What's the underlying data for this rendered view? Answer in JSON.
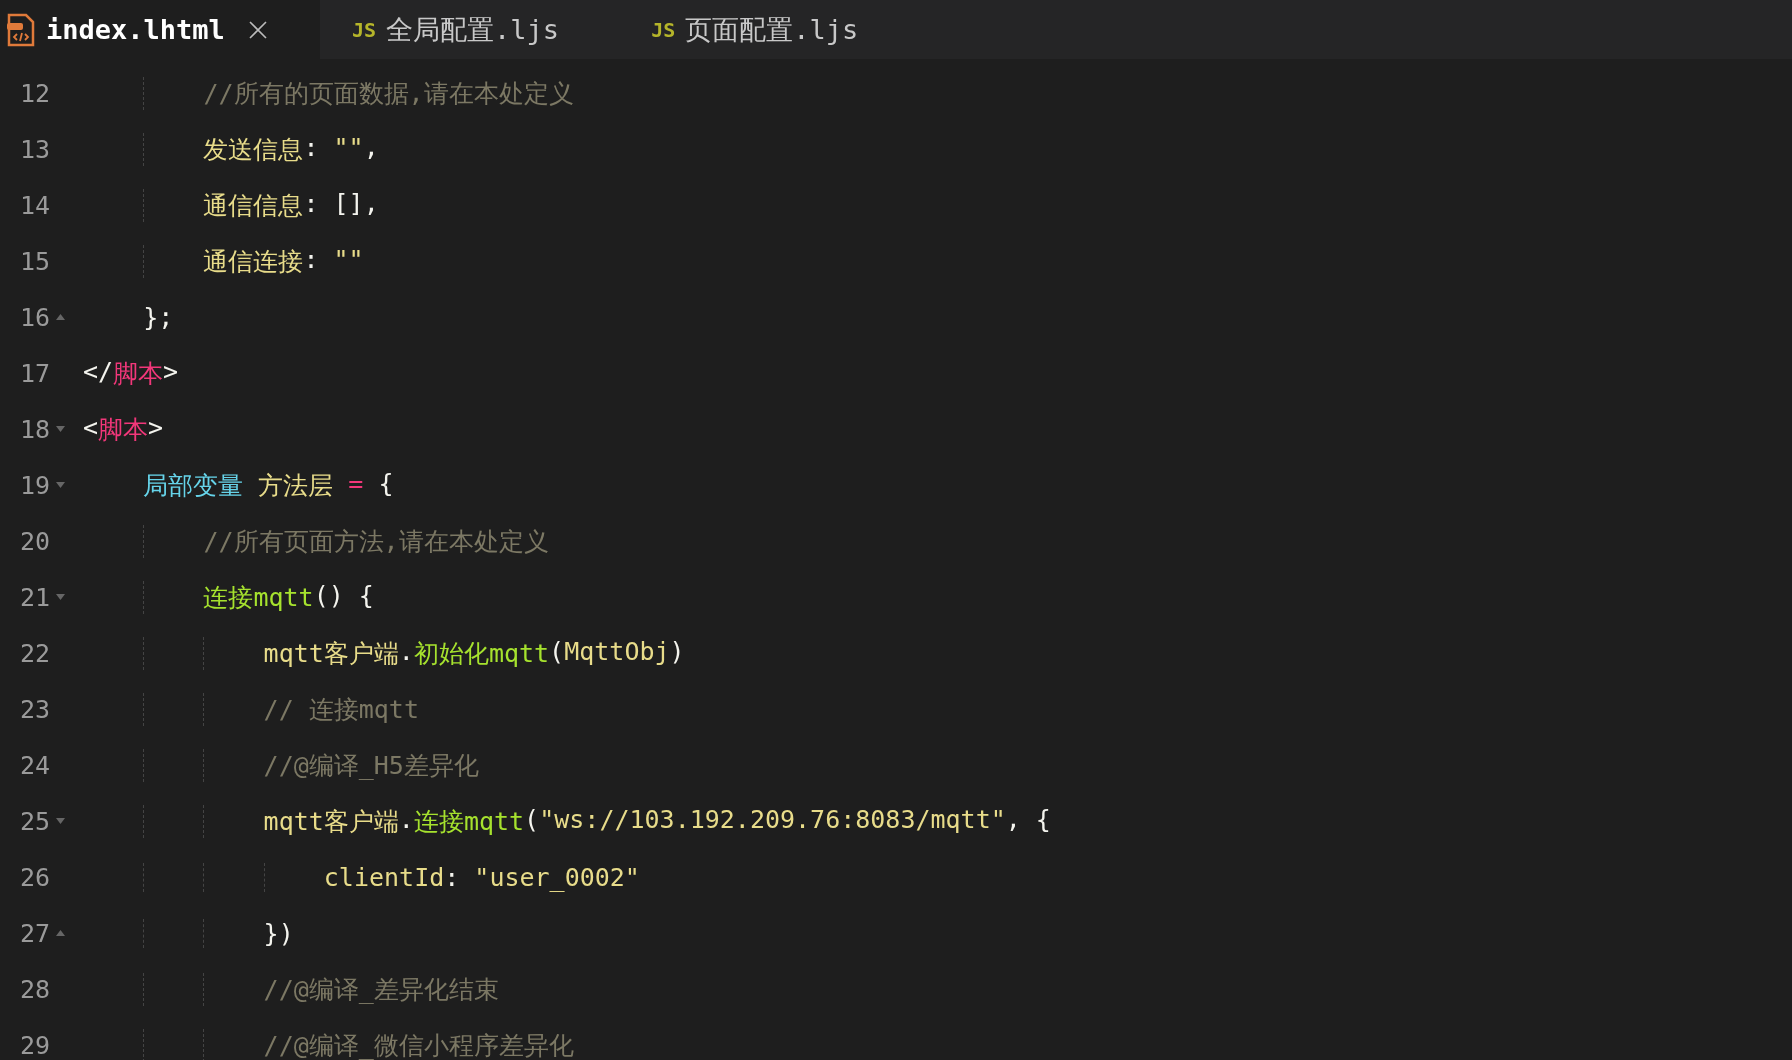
{
  "tabs": [
    {
      "label": "index.lhtml",
      "kind": "html",
      "selected": true
    },
    {
      "label": "全局配置.ljs",
      "kind": "js",
      "badge": "JS",
      "selected": false
    },
    {
      "label": "页面配置.ljs",
      "kind": "js",
      "badge": "JS",
      "selected": false
    }
  ],
  "lines": [
    {
      "number": "12",
      "tokens": [
        {
          "text": "        //所有的页面数据,请在本处定义",
          "kind": "comment"
        }
      ]
    },
    {
      "number": "13",
      "tokens": [
        {
          "text": "        发送信息",
          "kind": "ident"
        },
        {
          "text": ": ",
          "kind": "plain"
        },
        {
          "text": "\"\"",
          "kind": "string"
        },
        {
          "text": ",",
          "kind": "plain"
        }
      ]
    },
    {
      "number": "14",
      "tokens": [
        {
          "text": "        通信信息",
          "kind": "ident"
        },
        {
          "text": ": [],",
          "kind": "plain"
        }
      ]
    },
    {
      "number": "15",
      "tokens": [
        {
          "text": "        通信连接",
          "kind": "ident"
        },
        {
          "text": ": ",
          "kind": "plain"
        },
        {
          "text": "\"\"",
          "kind": "string"
        }
      ]
    },
    {
      "number": "16",
      "fold_end": true,
      "tokens": [
        {
          "text": "    };",
          "kind": "plain"
        }
      ]
    },
    {
      "number": "17",
      "tokens": [
        {
          "text": "</",
          "kind": "plain"
        },
        {
          "text": "脚本",
          "kind": "tag"
        },
        {
          "text": ">",
          "kind": "plain"
        }
      ]
    },
    {
      "number": "18",
      "fold_start": true,
      "tokens": [
        {
          "text": "<",
          "kind": "plain"
        },
        {
          "text": "脚本",
          "kind": "tag"
        },
        {
          "text": ">",
          "kind": "plain"
        }
      ]
    },
    {
      "number": "19",
      "fold_start": true,
      "tokens": [
        {
          "text": "    局部变量",
          "kind": "keyword"
        },
        {
          "text": " 方法层",
          "kind": "ident"
        },
        {
          "text": " =",
          "kind": "operator"
        },
        {
          "text": " {",
          "kind": "plain"
        }
      ]
    },
    {
      "number": "20",
      "tokens": [
        {
          "text": "        //所有页面方法,请在本处定义",
          "kind": "comment"
        }
      ]
    },
    {
      "number": "21",
      "fold_start": true,
      "tokens": [
        {
          "text": "        连接mqtt",
          "kind": "func"
        },
        {
          "text": "() {",
          "kind": "plain"
        }
      ]
    },
    {
      "number": "22",
      "tokens": [
        {
          "text": "            mqtt客户端",
          "kind": "ident"
        },
        {
          "text": ".",
          "kind": "plain"
        },
        {
          "text": "初始化mqtt",
          "kind": "func"
        },
        {
          "text": "(",
          "kind": "plain"
        },
        {
          "text": "MqttObj",
          "kind": "ident"
        },
        {
          "text": ")",
          "kind": "plain"
        }
      ]
    },
    {
      "number": "23",
      "tokens": [
        {
          "text": "            // 连接mqtt",
          "kind": "comment"
        }
      ]
    },
    {
      "number": "24",
      "tokens": [
        {
          "text": "            //@编译_H5差异化",
          "kind": "comment"
        }
      ]
    },
    {
      "number": "25",
      "fold_start": true,
      "tokens": [
        {
          "text": "            mqtt客户端",
          "kind": "ident"
        },
        {
          "text": ".",
          "kind": "plain"
        },
        {
          "text": "连接mqtt",
          "kind": "func"
        },
        {
          "text": "(",
          "kind": "plain"
        },
        {
          "text": "\"ws://103.192.209.76:8083/mqtt\"",
          "kind": "string"
        },
        {
          "text": ", {",
          "kind": "plain"
        }
      ]
    },
    {
      "number": "26",
      "tokens": [
        {
          "text": "                clientId",
          "kind": "ident"
        },
        {
          "text": ": ",
          "kind": "plain"
        },
        {
          "text": "\"user_0002\"",
          "kind": "string"
        }
      ]
    },
    {
      "number": "27",
      "fold_end": true,
      "tokens": [
        {
          "text": "            })",
          "kind": "plain"
        }
      ]
    },
    {
      "number": "28",
      "tokens": [
        {
          "text": "            //@编译_差异化结束",
          "kind": "comment"
        }
      ]
    },
    {
      "number": "29",
      "tokens": [
        {
          "text": "            //@编译_微信小程序差异化",
          "kind": "comment"
        }
      ]
    }
  ]
}
